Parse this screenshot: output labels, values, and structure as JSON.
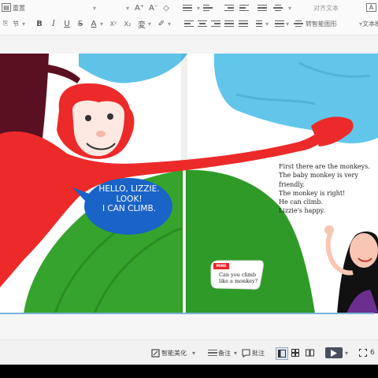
{
  "toolbar": {
    "font_name": "重置",
    "section_label": "节",
    "text_direction_label": "对齐文本",
    "smart_graphic_label": "转智能图形",
    "textbox_label": "文本框",
    "dropdown": "▾",
    "bold": "B",
    "italic": "I",
    "underline": "U",
    "strikethrough": "S",
    "font_color": "A",
    "superscript": "X²",
    "subscript": "X₂",
    "font_grow": "A⁺",
    "font_shrink": "A⁻",
    "phonetic": "変",
    "eraser": "◇",
    "highlight": "✐",
    "section_icon": "⎘",
    "font_icon": "▤",
    "textbox_icon": "A"
  },
  "slide": {
    "speech_bubble": [
      "HELLO, LIZZIE.",
      "LOOK!",
      "I CAN CLIMB."
    ],
    "story_lines": [
      "First there are the monkeys.",
      "The baby monkey is very",
      "friendly.",
      "The monkey is right!",
      "He can climb.",
      "Lizzie's happy."
    ],
    "question_tag": "MINE",
    "question_lines": [
      "Can you climb",
      "like a monkey?"
    ]
  },
  "statusbar": {
    "beautify_label": "智能美化",
    "notes_label": "备注",
    "comment_label": "批注",
    "zoom": "6",
    "dropdown": "▾"
  },
  "colors": {
    "monkey": "#ec2a2a",
    "speech_bubble": "#1a63c7",
    "tree_trunk": "#5a1020",
    "sky": "#5fc3e8",
    "grass": "#36a42c",
    "slide_border": "#7bb3d6"
  }
}
